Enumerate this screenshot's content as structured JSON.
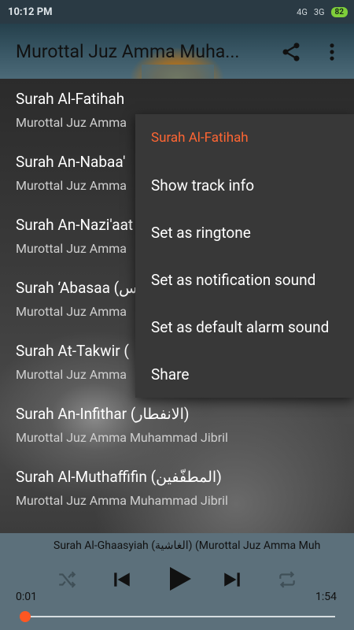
{
  "statusbar": {
    "time": "10:12 PM",
    "signal1": "4G",
    "signal2": "3G",
    "battery": "82"
  },
  "header": {
    "title": "Murottal Juz Amma Muha..."
  },
  "list": [
    {
      "title": "Surah Al-Fatihah",
      "subtitle": "Murottal Juz Amma"
    },
    {
      "title": "Surah An-Nabaa'",
      "subtitle": "Murottal Juz Amma"
    },
    {
      "title": "Surah An-Nazi'aat",
      "subtitle": "Murottal Juz Amma"
    },
    {
      "title": "Surah ‘Abasaa (س",
      "subtitle": "Murottal Juz Amma"
    },
    {
      "title": "Surah At-Takwir (",
      "subtitle": "Murottal Juz Amma"
    },
    {
      "title": "Surah An-Infithar (الانفطار)",
      "subtitle": "Murottal Juz Amma Muhammad Jibril"
    },
    {
      "title": "Surah Al-Muthaffifin (المطفّفين)",
      "subtitle": "Murottal Juz Amma Muhammad Jibril"
    }
  ],
  "menu": {
    "header": "Surah Al-Fatihah",
    "items": [
      "Show track info",
      "Set as ringtone",
      "Set as notification sound",
      "Set as default alarm sound",
      "Share"
    ]
  },
  "player": {
    "now_playing": "Surah Al-Ghaasyiah (الغاشية) (Murottal Juz Amma Muh",
    "elapsed": "0:01",
    "total": "1:54",
    "progress_fraction": 0.01
  },
  "colors": {
    "accent": "#ff5722",
    "menu_header": "#ff6633",
    "player_bg": "#5c707b",
    "menu_bg": "#383838"
  },
  "icons": [
    "share-icon",
    "more-vert-icon",
    "shuffle-icon",
    "skip-previous-icon",
    "play-icon",
    "skip-next-icon",
    "repeat-icon"
  ]
}
